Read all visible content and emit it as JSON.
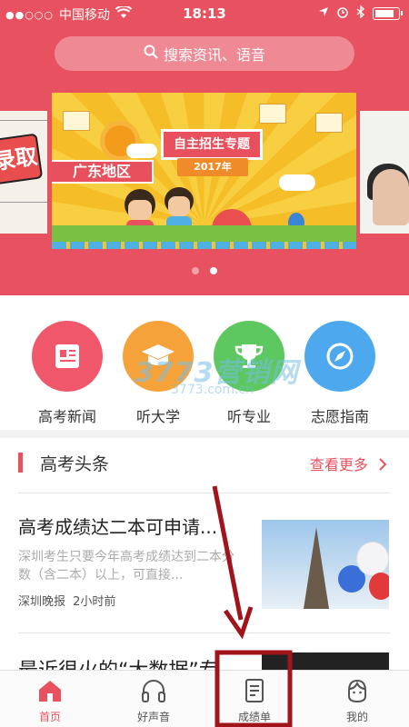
{
  "status_bar": {
    "signal": "●●○○○",
    "carrier": "中国移动",
    "time": "18:13",
    "battery_level": 0.85
  },
  "search": {
    "placeholder": "搜索资讯、语音"
  },
  "banner": {
    "left_slide_text": "录取",
    "main_title": "自主招生专题",
    "year": "2017年",
    "region": "广东地区",
    "pages": 2,
    "active_page": 2
  },
  "quick_nav": {
    "items": [
      {
        "label": "高考新闻",
        "color": "#f0576a",
        "icon": "newspaper-icon"
      },
      {
        "label": "听大学",
        "color": "#f6a23a",
        "icon": "graduation-cap-icon"
      },
      {
        "label": "听专业",
        "color": "#5cc85f",
        "icon": "trophy-icon"
      },
      {
        "label": "志愿指南",
        "color": "#4da8ee",
        "icon": "compass-icon"
      }
    ],
    "watermark": "3773营销网",
    "watermark_sub": "3773.com.cn"
  },
  "news": {
    "section_title": "高考头条",
    "more_label": "查看更多",
    "articles": [
      {
        "title": "高考成绩达二本可申请...",
        "summary": "深圳考生只要今年高考成绩达到二本分数（含二本）以上，可直接...",
        "source": "深圳晚报",
        "time": "2小时前"
      },
      {
        "title": "最近很火的“大数据”专"
      }
    ]
  },
  "tab_bar": {
    "tabs": [
      {
        "label": "首页",
        "icon": "home-icon",
        "active": true
      },
      {
        "label": "好声音",
        "icon": "headphones-icon",
        "active": false
      },
      {
        "label": "成绩单",
        "icon": "report-icon",
        "active": false
      },
      {
        "label": "我的",
        "icon": "profile-icon",
        "active": false
      }
    ]
  },
  "colors": {
    "brand_red": "#e8515f",
    "annotation": "#a0141c"
  }
}
